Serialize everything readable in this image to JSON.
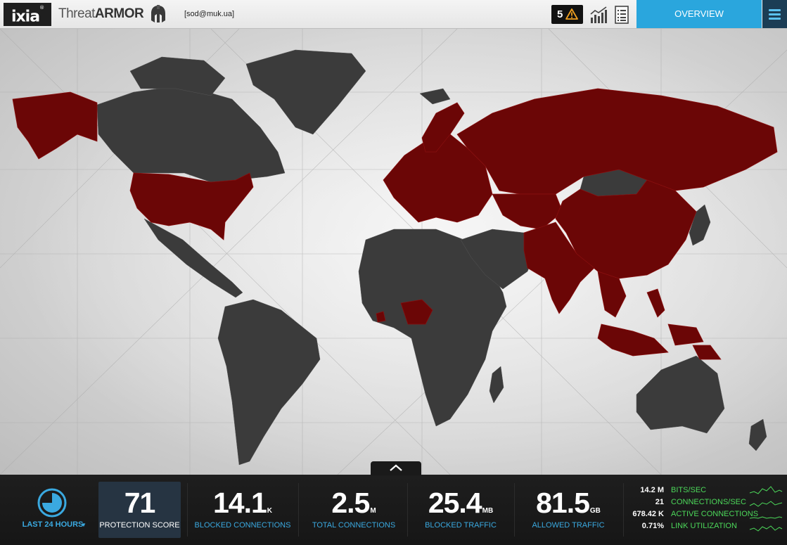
{
  "header": {
    "brand": "ixia",
    "product_light": "Threat",
    "product_bold": "ARMOR",
    "user": "[sod@muk.ua]",
    "alert_count": "5",
    "overview_label": "OVERVIEW"
  },
  "map": {
    "land_color": "#3b3b3b",
    "threat_color": "#6b0606",
    "highlighted_regions": [
      "Alaska",
      "United States",
      "Europe",
      "Russia",
      "China",
      "India",
      "Southeast Asia",
      "Nigeria",
      "Papua New Guinea"
    ]
  },
  "footer": {
    "time_range": "LAST 24 HOURS",
    "stats": [
      {
        "value": "71",
        "unit": "",
        "label": "PROTECTION SCORE"
      },
      {
        "value": "14.1",
        "unit": "K",
        "label": "BLOCKED CONNECTIONS"
      },
      {
        "value": "2.5",
        "unit": "M",
        "label": "TOTAL CONNECTIONS"
      },
      {
        "value": "25.4",
        "unit": "MB",
        "label": "BLOCKED TRAFFIC"
      },
      {
        "value": "81.5",
        "unit": "GB",
        "label": "ALLOWED TRAFFIC"
      }
    ],
    "metrics": [
      {
        "value": "14.2 M",
        "label": "BITS/SEC"
      },
      {
        "value": "21",
        "label": "CONNECTIONS/SEC"
      },
      {
        "value": "678.42 K",
        "label": "ACTIVE CONNECTIONS"
      },
      {
        "value": "0.71%",
        "label": "LINK UTILIZATION"
      }
    ]
  },
  "colors": {
    "accent_blue": "#2aa6dd",
    "label_blue": "#3aa9e0",
    "metric_green": "#4cd85a"
  }
}
